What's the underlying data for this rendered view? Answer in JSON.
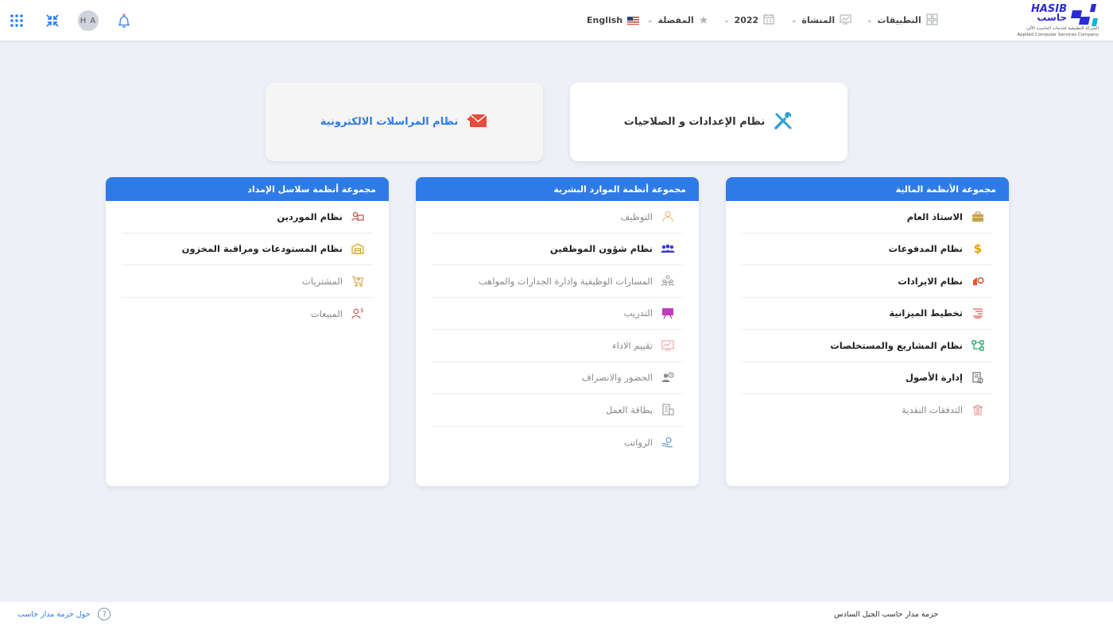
{
  "header": {
    "language_label": "English",
    "favorites_label": "المفضلة",
    "year_label": "2022",
    "facility_label": "المنشاة",
    "apps_label": "التطبيقات",
    "avatar_initials": "H A",
    "logo_brand_ar": "حاسب",
    "logo_brand_en": "HASIB",
    "logo_company_ar": "الشركة التطبيقية لخدمات الحاسب الآلي",
    "logo_company_en": "Applied Computer Services Company"
  },
  "cards": {
    "settings_label": "نظام الإعدادات و الصلاحيات",
    "mail_label": "نظام المراسلات الالكترونية"
  },
  "groups": {
    "financial": {
      "title": "مجموعة الأنظمة المالية",
      "items": [
        {
          "label": "الاستاذ العام",
          "active": true,
          "icon": "briefcase-icon"
        },
        {
          "label": "نظام المدفوعات",
          "active": true,
          "icon": "dollar-icon"
        },
        {
          "label": "نظام الايرادات",
          "active": true,
          "icon": "revenue-icon"
        },
        {
          "label": "تخطيط الميزانية",
          "active": true,
          "icon": "budget-icon"
        },
        {
          "label": "نظام المشاريع والمستخلصات",
          "active": true,
          "icon": "projects-icon"
        },
        {
          "label": "إدارة الأصول",
          "active": true,
          "icon": "assets-icon"
        },
        {
          "label": "التدفقات النقدية",
          "active": false,
          "icon": "bank-icon"
        }
      ]
    },
    "hr": {
      "title": "مجموعة أنظمة الموارد البشرية",
      "items": [
        {
          "label": "التوظيف",
          "active": false,
          "icon": "recruit-icon"
        },
        {
          "label": "نظام شؤون الموظفين",
          "active": true,
          "icon": "employees-icon"
        },
        {
          "label": "المسارات الوظيفية وادارة الجدارات والمواهب",
          "active": false,
          "icon": "career-icon"
        },
        {
          "label": "التدريب",
          "active": false,
          "icon": "training-icon"
        },
        {
          "label": "تقييم الاداء",
          "active": false,
          "icon": "evaluation-icon"
        },
        {
          "label": "الحضور والانصراف",
          "active": false,
          "icon": "attendance-icon"
        },
        {
          "label": "بطاقة العمل",
          "active": false,
          "icon": "workcard-icon"
        },
        {
          "label": "الرواتب",
          "active": false,
          "icon": "payroll-icon"
        }
      ]
    },
    "supply_chain": {
      "title": "مجموعة أنظمة سلاسل الإمداد",
      "items": [
        {
          "label": "نظام الموردين",
          "active": true,
          "icon": "suppliers-icon"
        },
        {
          "label": "نظام المستودعات ومراقبة المخزون",
          "active": true,
          "icon": "warehouse-icon"
        },
        {
          "label": "المشتريات",
          "active": false,
          "icon": "cart-icon"
        },
        {
          "label": "المبيعات",
          "active": false,
          "icon": "sales-icon"
        }
      ]
    }
  },
  "footer": {
    "about_label": "حول حزمة مدار حاسب",
    "copy_label": "حزمة مدار حاسب الجيل السادس"
  },
  "colors": {
    "accent": "#2f7be5",
    "background": "#edf0f7"
  }
}
